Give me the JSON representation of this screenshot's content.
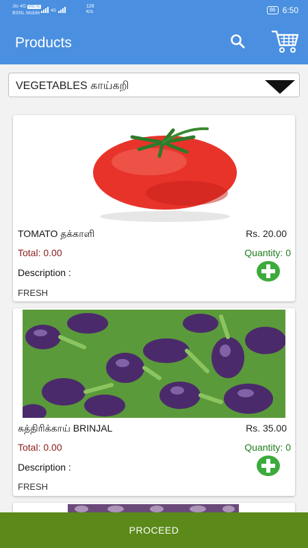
{
  "status_bar": {
    "carrier_line1": "Jio 4G",
    "carrier_line2": "BSNL Mobile",
    "net_badge": "VoLTE",
    "net_label": "4G",
    "speed_value": "126",
    "speed_unit": "K/s",
    "battery": "86",
    "time": "6:50"
  },
  "header": {
    "title": "Products",
    "search_icon": "search-icon",
    "cart_icon": "cart-icon"
  },
  "category": {
    "selected": "VEGETABLES காய்கறி"
  },
  "products": [
    {
      "name": "TOMATO  தக்காளி",
      "price": "Rs. 20.00",
      "total": "Total: 0.00",
      "quantity": "Quantity: 0",
      "description_label": "Description :",
      "description": "FRESH"
    },
    {
      "name": "கத்திரிக்காய் BRINJAL",
      "price": "Rs. 35.00",
      "total": "Total: 0.00",
      "quantity": "Quantity: 0",
      "description_label": "Description :",
      "description": "FRESH"
    }
  ],
  "footer": {
    "proceed_label": "PROCEED"
  },
  "colors": {
    "primary": "#4a8fe0",
    "proceed": "#5b8a1a",
    "total_text": "#8b1a1a",
    "quantity_text": "#1e7d1e",
    "add_button": "#3cab3c"
  }
}
